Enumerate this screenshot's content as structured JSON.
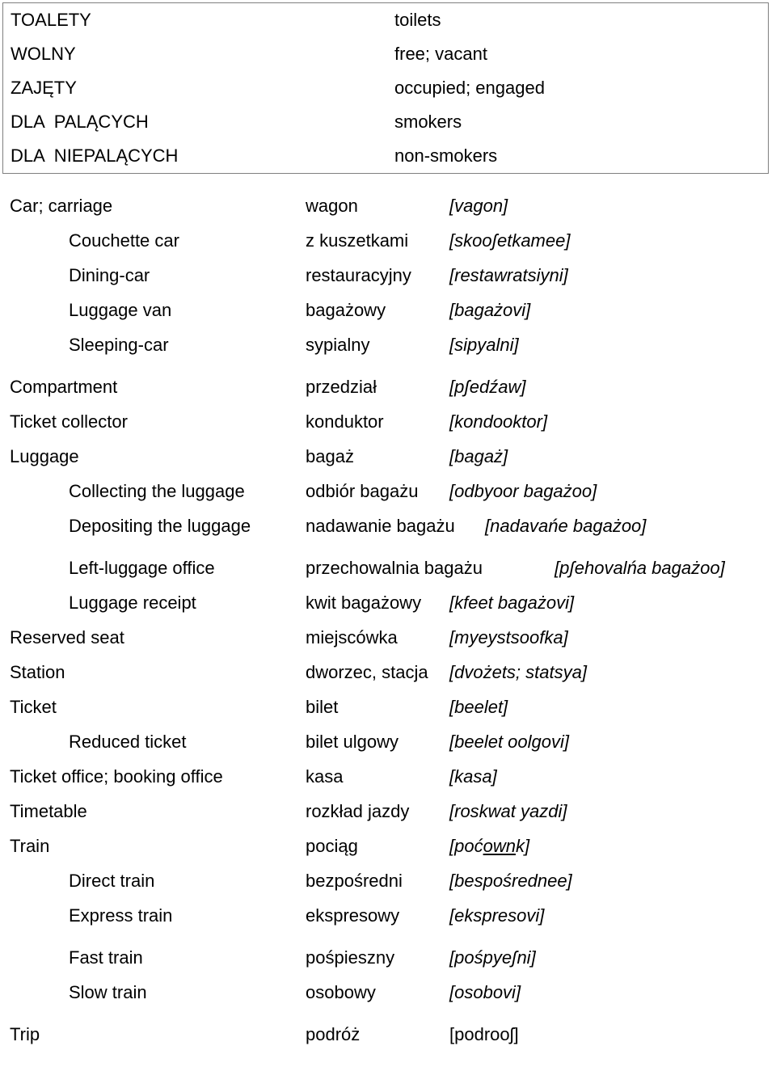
{
  "sign_box": {
    "rows": [
      {
        "polish": "TOALETY",
        "english": "toilets"
      },
      {
        "polish": "WOLNY",
        "english": "free; vacant"
      },
      {
        "polish": "ZAJĘTY",
        "english": "occupied; engaged"
      },
      {
        "polish": "DLA  PALĄCYCH",
        "english": "smokers"
      },
      {
        "polish": "DLA  NIEPALĄCYCH",
        "english": "non-smokers"
      }
    ]
  },
  "glossary": {
    "rows": [
      {
        "english": "Car; carriage",
        "polish": "wagon",
        "transcription": "[vagon]"
      },
      {
        "english": "Couchette car",
        "polish": "z kuszetkami",
        "transcription": "[skooʃetkamee]"
      },
      {
        "english": "Dining-car",
        "polish": "restauracyjny",
        "transcription": "[restawratsiyni]"
      },
      {
        "english": "Luggage van",
        "polish": "bagażowy",
        "transcription": "[bagażovi]"
      },
      {
        "english": "Sleeping-car",
        "polish": "sypialny",
        "transcription": "[sipyalni]"
      },
      {
        "english": "Compartment",
        "polish": "przedział",
        "transcription": "[pʃedźaw]"
      },
      {
        "english": "Ticket collector",
        "polish": "konduktor",
        "transcription": "[kondooktor]"
      },
      {
        "english": "Luggage",
        "polish": "bagaż",
        "transcription": "[bagaż]"
      },
      {
        "english": "Collecting the luggage",
        "polish": "odbiór bagażu",
        "transcription": "[odbyoor bagażoo]"
      },
      {
        "english": "Depositing the luggage",
        "polish": "nadawanie bagażu",
        "transcription": "[nadavańe bagażoo]"
      },
      {
        "english": "Left-luggage office",
        "polish": "przechowalnia bagażu",
        "transcription": "[pʃehovalńa bagażoo]"
      },
      {
        "english": "Luggage receipt",
        "polish": "kwit bagażowy",
        "transcription": "[kfeet bagażovi]"
      },
      {
        "english": "Reserved seat",
        "polish": "miejscówka",
        "transcription": "[myeystsoofka]"
      },
      {
        "english": "Station",
        "polish": "dworzec, stacja",
        "transcription": "[dvożets; statsya]"
      },
      {
        "english": "Ticket",
        "polish": "bilet",
        "transcription": "[beelet]"
      },
      {
        "english": "Reduced ticket",
        "polish": "bilet ulgowy",
        "transcription": "[beelet oolgovi]"
      },
      {
        "english": "Ticket office; booking office",
        "polish": "kasa",
        "transcription": "[kasa]"
      },
      {
        "english": "Timetable",
        "polish": "rozkład jazdy",
        "transcription": "[roskwat yazdi]"
      },
      {
        "english": "Train",
        "polish": "pociąg",
        "transcription": "[poćownk]",
        "transcription_parts": {
          "pre": "[poć",
          "underlined": "own",
          "post": "k]"
        }
      },
      {
        "english": "Direct train",
        "polish": "bezpośredni",
        "transcription": "[bespośrednee]"
      },
      {
        "english": "Express train",
        "polish": "ekspresowy",
        "transcription": "[ekspresovi]"
      },
      {
        "english": "Fast train",
        "polish": "pośpieszny",
        "transcription": "[pośpyeʃni]"
      },
      {
        "english": "Slow train",
        "polish": "osobowy",
        "transcription": "[osobovi]"
      },
      {
        "english": "Trip",
        "polish": "podróż",
        "transcription": "[podrooʃ]"
      }
    ]
  },
  "colors": {
    "text": "#000000",
    "box_border": "#808080",
    "background": "#ffffff"
  }
}
